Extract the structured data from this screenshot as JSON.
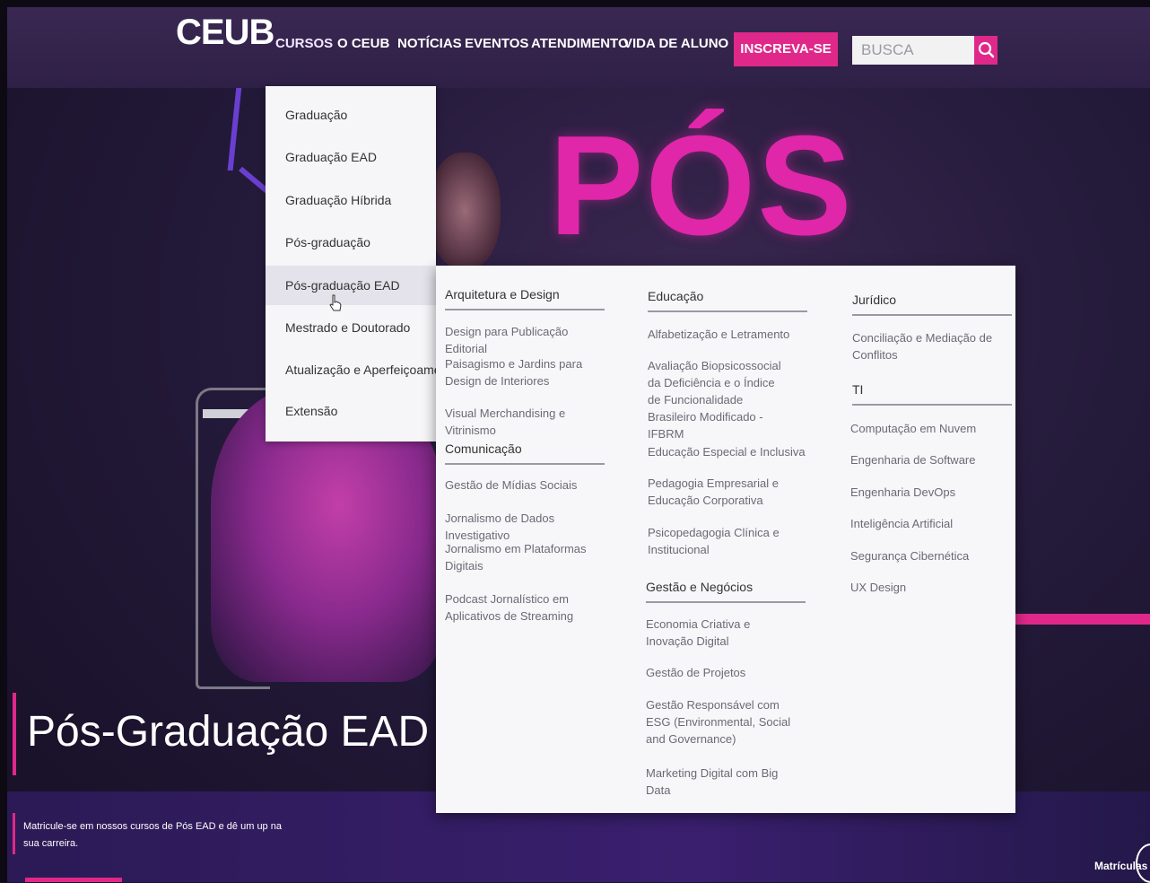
{
  "header": {
    "logo": "CEUB",
    "nav": [
      {
        "label": "CURSOS"
      },
      {
        "label": "O CEUB"
      },
      {
        "label": "NOTÍCIAS"
      },
      {
        "label": "EVENTOS"
      },
      {
        "label": "ATENDIMENTO"
      },
      {
        "label": "VIDA DE ALUNO"
      }
    ],
    "cta_label": "INSCREVA-SE",
    "search_placeholder": "BUSCA"
  },
  "hero": {
    "big_text": "PÓS",
    "title": "Pós-Graduação EAD",
    "subtitle": "Matricule-se em nossos cursos de Pós EAD e dê um up na sua carreira.",
    "matriculas_label": "Matrículas"
  },
  "dropdown": {
    "hovered": "Pós-graduação EAD",
    "items": [
      {
        "label": "Graduação"
      },
      {
        "label": "Graduação EAD"
      },
      {
        "label": "Graduação Híbrida"
      },
      {
        "label": "Pós-graduação"
      },
      {
        "label": "Pós-graduação EAD"
      },
      {
        "label": "Mestrado e Doutorado"
      },
      {
        "label": "Atualização e Aperfeiçoamento"
      },
      {
        "label": "Extensão"
      }
    ]
  },
  "mega_menu": {
    "columns": [
      {
        "groups": [
          {
            "heading": "Arquitetura e Design",
            "items": [
              "Design para Publicação Editorial",
              "Paisagismo e Jardins para Design de Interiores",
              "Visual Merchandising e Vitrinismo"
            ]
          },
          {
            "heading": "Comunicação",
            "items": [
              "Gestão de Mídias Sociais",
              "Jornalismo de Dados Investigativo",
              "Jornalismo em Plataformas Digitais",
              "Podcast Jornalístico em Aplicativos de Streaming"
            ]
          }
        ]
      },
      {
        "groups": [
          {
            "heading": "Educação",
            "items": [
              "Alfabetização e Letramento",
              "Avaliação Biopsicossocial da Deficiência e o Índice de Funcionalidade Brasileiro Modificado - IFBRM",
              "Educação Especial e Inclusiva",
              "Pedagogia Empresarial e Educação Corporativa",
              "Psicopedagogia Clínica e Institucional"
            ]
          },
          {
            "heading": "Gestão e Negócios",
            "items": [
              "Economia Criativa e Inovação Digital",
              "Gestão de Projetos",
              "Gestão Responsável com ESG (Environmental, Social and Governance)",
              "Marketing Digital com Big Data"
            ]
          }
        ]
      },
      {
        "groups": [
          {
            "heading": "Jurídico",
            "items": [
              "Conciliação e Mediação de Conflitos"
            ]
          },
          {
            "heading": "TI",
            "items": [
              "Computação em Nuvem",
              "Engenharia de Software",
              "Engenharia DevOps",
              "Inteligência Artificial",
              "Segurança Cibernética",
              "UX Design"
            ]
          }
        ]
      }
    ]
  },
  "colors": {
    "accent_pink": "#e0288a",
    "header_bg": "#3a2852",
    "menu_bg": "#f7f7f9"
  },
  "icons": {
    "search": "search-icon"
  }
}
